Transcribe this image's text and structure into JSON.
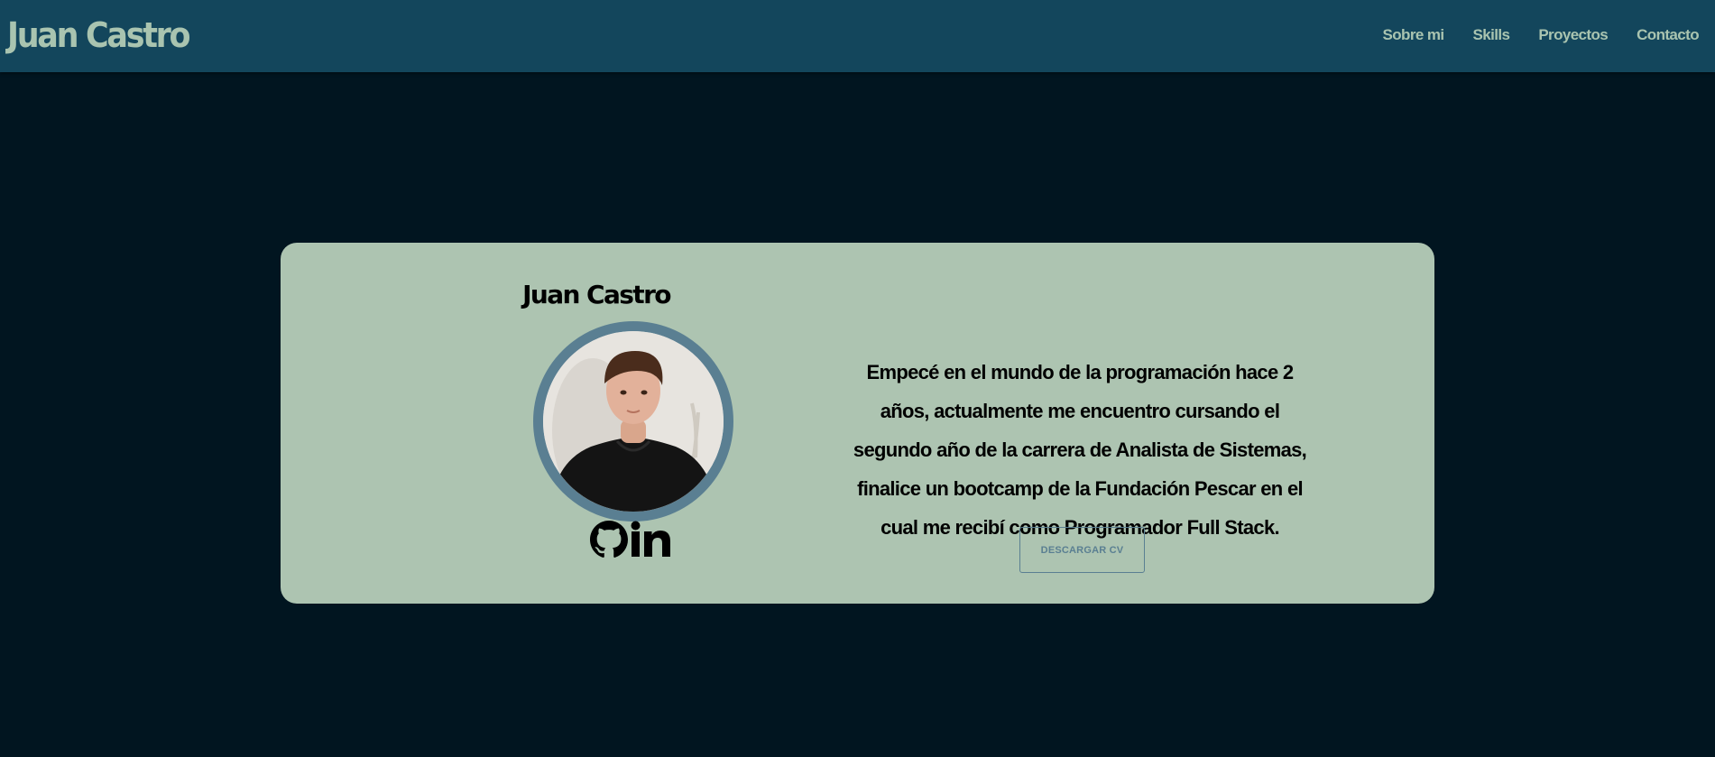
{
  "header": {
    "brand": "Juan Castro",
    "nav": [
      "Sobre mi",
      "Skills",
      "Proyectos",
      "Contacto"
    ]
  },
  "profile": {
    "name": "Juan Castro",
    "bio": "Empecé en el mundo de la programación hace 2 años, actualmente me encuentro cursando el segundo año de la carrera de Analista de Sistemas, finalice un bootcamp de la Fundación Pescar en el cual me recibí como Programador Full Stack.",
    "cv_button": "DESCARGAR CV",
    "social_icons": [
      "github-icon",
      "linkedin-icon"
    ]
  },
  "colors": {
    "background": "#011520",
    "navbar": "#13465c",
    "accent": "#a9c4b0",
    "card": "#adc4b1",
    "avatar_border": "#5a7f92"
  }
}
